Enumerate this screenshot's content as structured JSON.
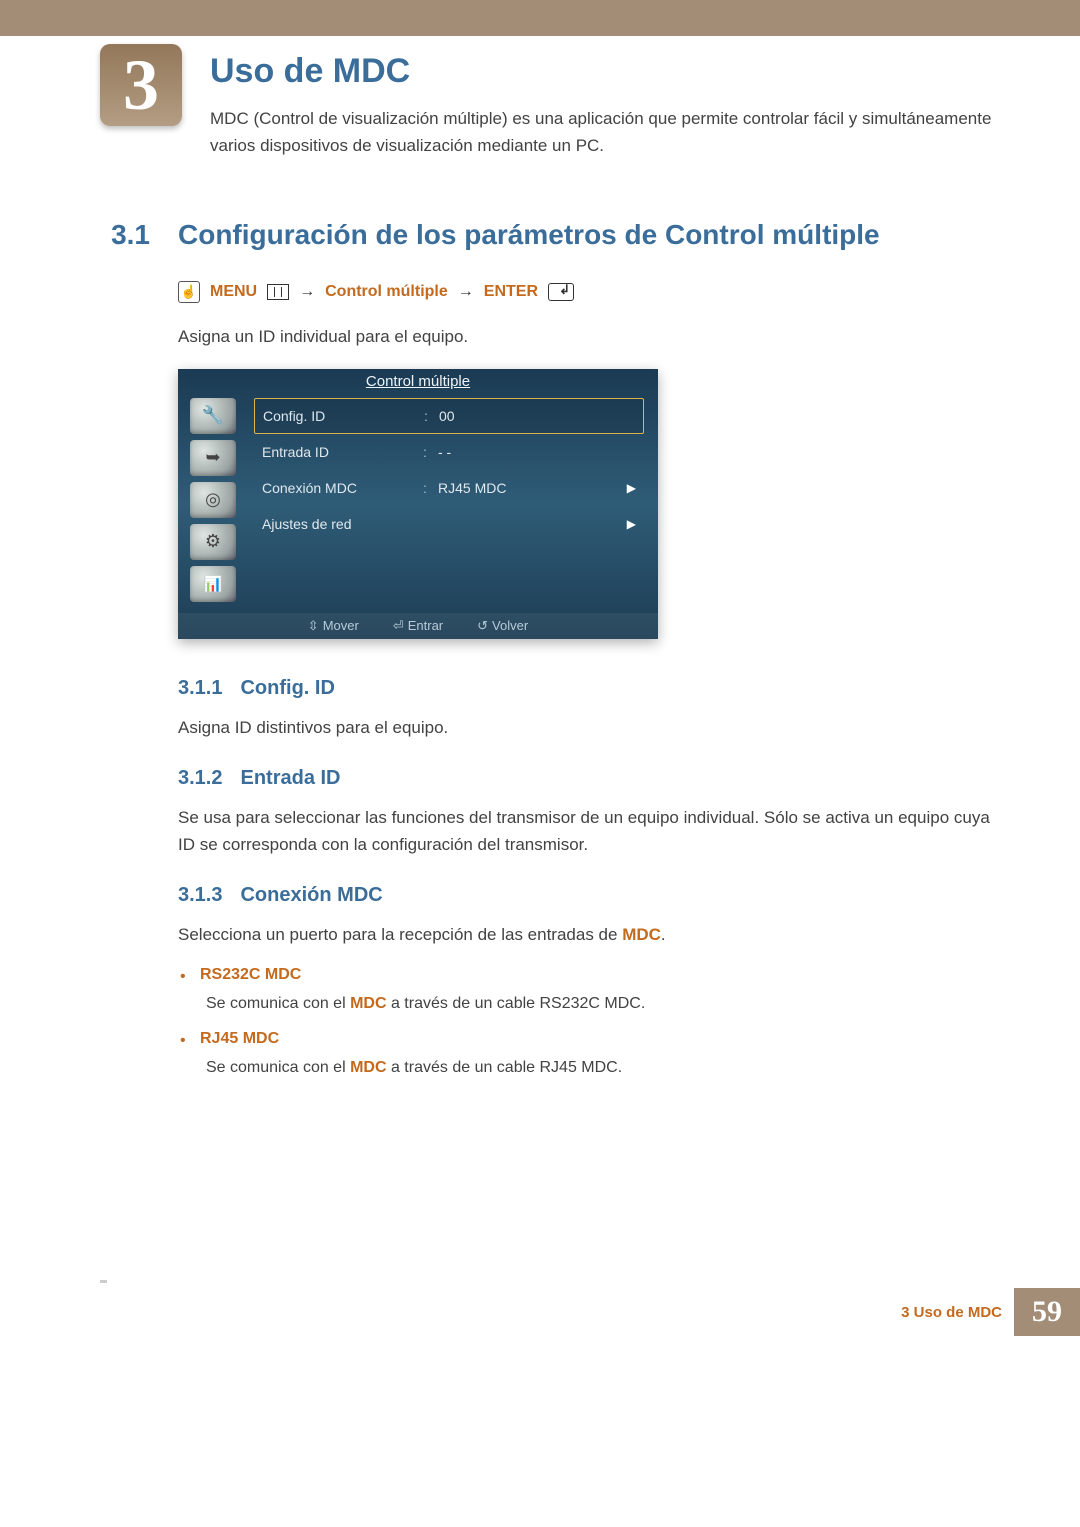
{
  "chapter": {
    "number": "3",
    "title": "Uso de MDC",
    "description": "MDC (Control de visualización múltiple) es una aplicación que permite controlar fácil y simultáneamente varios dispositivos de visualización mediante un PC."
  },
  "section": {
    "number": "3.1",
    "title": "Configuración de los parámetros de Control múltiple",
    "nav": {
      "menu_label": "MENU",
      "step": "Control múltiple",
      "enter_label": "ENTER",
      "arrow": "→"
    },
    "intro": "Asigna un ID individual para el equipo."
  },
  "osd": {
    "title": "Control múltiple",
    "rows": [
      {
        "label": "Config. ID",
        "value": "00",
        "arrow": false,
        "selected": true
      },
      {
        "label": "Entrada ID",
        "value": "- -",
        "arrow": false,
        "selected": false
      },
      {
        "label": "Conexión MDC",
        "value": "RJ45 MDC",
        "arrow": true,
        "selected": false
      },
      {
        "label": "Ajustes de red",
        "value": "",
        "arrow": true,
        "selected": false
      }
    ],
    "footer": {
      "move": "Mover",
      "enter": "Entrar",
      "ret": "Volver"
    }
  },
  "subsections": [
    {
      "num": "3.1.1",
      "title": "Config. ID",
      "text": "Asigna ID distintivos para el equipo."
    },
    {
      "num": "3.1.2",
      "title": "Entrada ID",
      "text": "Se usa para seleccionar las funciones del transmisor de un equipo individual. Sólo se activa un equipo cuya ID se corresponda con la configuración del transmisor."
    },
    {
      "num": "3.1.3",
      "title": "Conexión MDC",
      "text_pre": "Selecciona un puerto para la recepción de las entradas de ",
      "text_hl": "MDC",
      "text_post": ".",
      "options": [
        {
          "name": "RS232C MDC",
          "desc_pre": "Se comunica con el ",
          "desc_hl": "MDC",
          "desc_post": " a través de un cable RS232C MDC."
        },
        {
          "name": "RJ45 MDC",
          "desc_pre": "Se comunica con el ",
          "desc_hl": "MDC",
          "desc_post": " a través de un cable RJ45 MDC."
        }
      ]
    }
  ],
  "footer": {
    "crumb": "3 Uso de MDC",
    "page": "59"
  }
}
